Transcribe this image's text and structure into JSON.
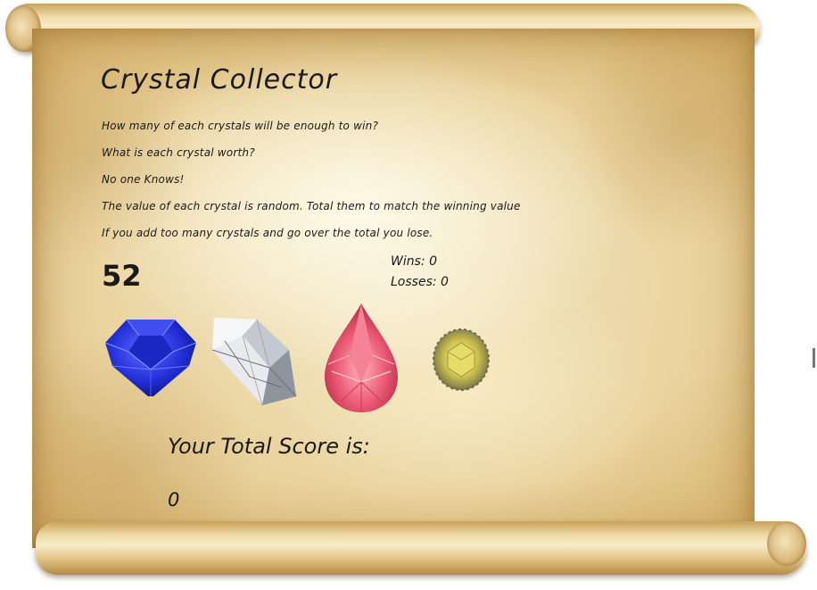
{
  "game": {
    "title": "Crystal Collector",
    "instructions": [
      "How many of each crystals will be enough to win?",
      "What is each crystal worth?",
      "No one Knows!",
      "The value of each crystal is random. Total them to match the winning value",
      "If you add too many crystals and go over the total you lose."
    ],
    "target_number": "52",
    "wins_text": "Wins: 0",
    "losses_text": "Losses: 0",
    "score_label": "Your Total Score is:",
    "score_value": "0"
  },
  "crystals": [
    {
      "name": "blue sapphire",
      "color": "#1f2fd6"
    },
    {
      "name": "white diamond",
      "color": "#e6e8ec"
    },
    {
      "name": "pink pear",
      "color": "#e8566e"
    },
    {
      "name": "yellow round",
      "color": "#c9bf4a"
    }
  ],
  "colors": {
    "parchment": "#efdcaa",
    "ink": "#1a1a1a"
  }
}
